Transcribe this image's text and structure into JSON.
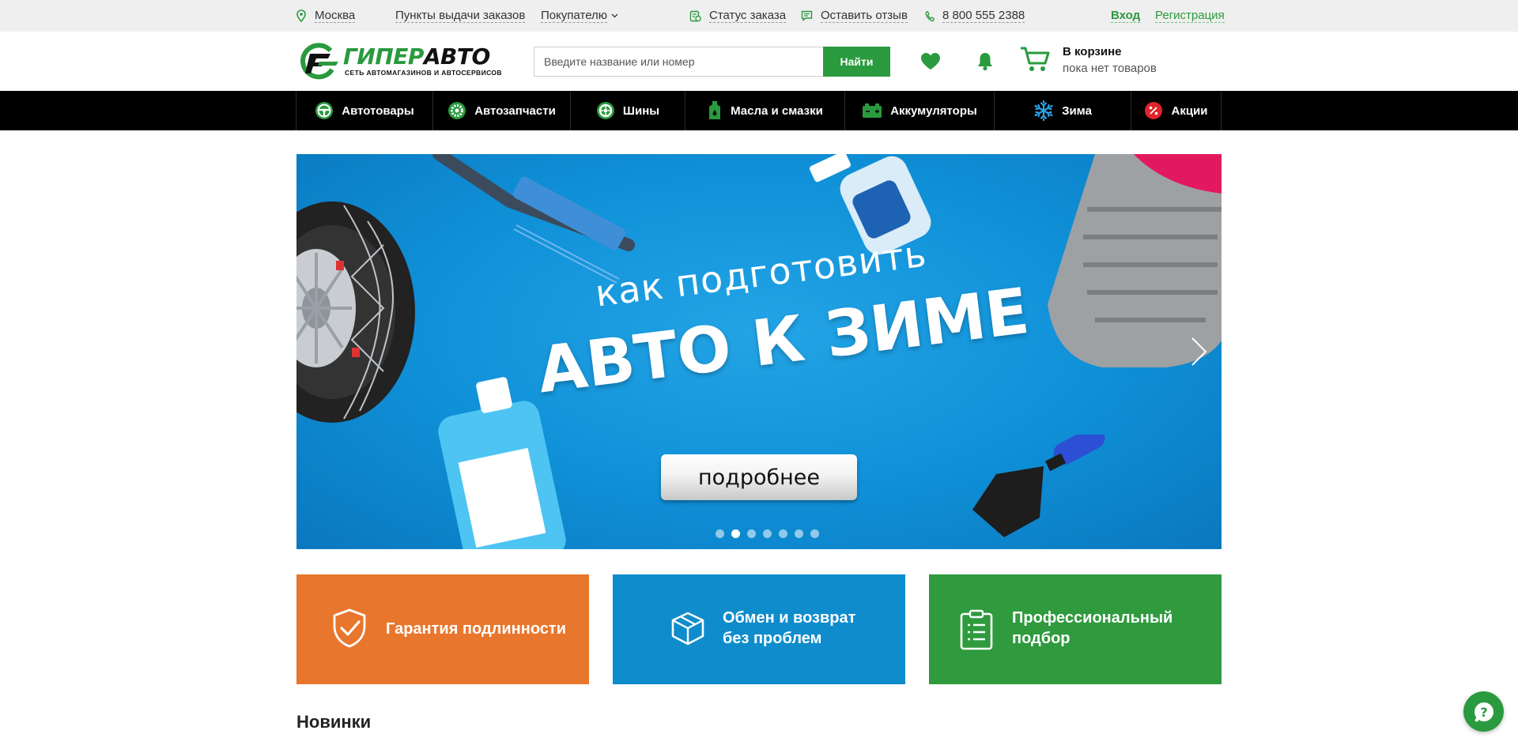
{
  "topbar": {
    "city": "Москва",
    "pickup_points": "Пункты выдачи заказов",
    "buyer_menu": "Покупателю",
    "order_status": "Статус заказа",
    "leave_review": "Оставить отзыв",
    "phone": "8 800 555 2388",
    "login": "Вход",
    "register": "Регистрация"
  },
  "header": {
    "logo_main_green": "ГИПЕР",
    "logo_main_black": "АВТО",
    "logo_sub": "СЕТЬ АВТОМАГАЗИНОВ И АВТОСЕРВИСОВ",
    "search_placeholder": "Введите название или номер",
    "search_button": "Найти",
    "cart_title": "В корзине",
    "cart_status": "пока нет товаров"
  },
  "nav": {
    "items": [
      {
        "label": "Автотовары",
        "icon": "steering-wheel-icon"
      },
      {
        "label": "Автозапчасти",
        "icon": "gear-icon"
      },
      {
        "label": "Шины",
        "icon": "tire-icon"
      },
      {
        "label": "Масла и смазки",
        "icon": "oil-bottle-icon"
      },
      {
        "label": "Аккумуляторы",
        "icon": "battery-icon"
      },
      {
        "label": "Зима",
        "icon": "snowflake-icon"
      },
      {
        "label": "Акции",
        "icon": "percent-icon"
      }
    ]
  },
  "banner": {
    "line1": "как подготовить",
    "line2": "АВТО К ЗИМЕ",
    "button": "подробнее",
    "slide_count": 7,
    "active_slide": 2
  },
  "features": [
    {
      "title": "Гарантия подлинности",
      "icon": "shield-check-icon",
      "color": "#e8762c"
    },
    {
      "title_line1": "Обмен и возврат",
      "title_line2": "без проблем",
      "icon": "box-icon",
      "color": "#0f8ccc"
    },
    {
      "title_line1": "Профессиональный",
      "title_line2": "подбор",
      "icon": "clipboard-icon",
      "color": "#2f9a3e"
    }
  ],
  "sections": {
    "new_arrivals": "Новинки"
  },
  "colors": {
    "brand_green": "#2a9a3e",
    "nav_bg": "#000000",
    "topbar_bg": "#efefef"
  }
}
